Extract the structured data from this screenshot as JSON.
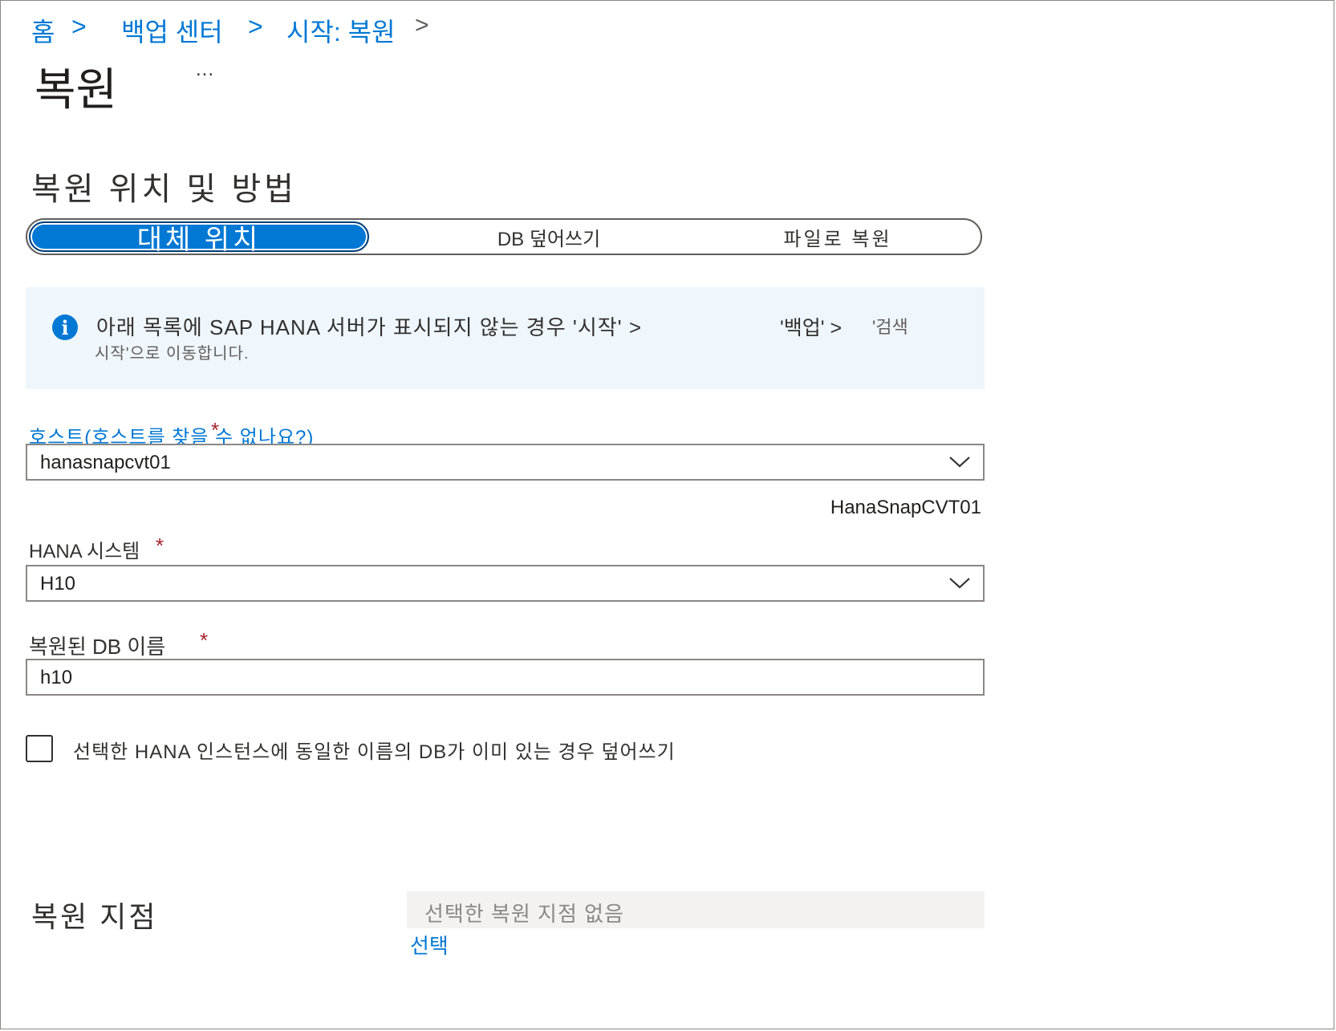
{
  "breadcrumb": {
    "home": "홈",
    "sep": ">",
    "backup_center": "백업 센터",
    "start_restore": "시작: 복원"
  },
  "page": {
    "title": "복원",
    "more": "..."
  },
  "section": {
    "title": "복원 위치 및 방법"
  },
  "restore_method_tabs": [
    {
      "label": "대체 위치",
      "selected": true
    },
    {
      "label": "DB 덮어쓰기",
      "selected": false
    },
    {
      "label": "파일로 복원",
      "selected": false
    }
  ],
  "info": {
    "line1": "아래 목록에 SAP HANA 서버가 표시되지 않는 경우 '시작' >",
    "line1_b": "'백업' >",
    "line1_c": "'검색",
    "line2": "시작'으로 이동합니다."
  },
  "host": {
    "label": "호스트(호스트를 찾을 수 없나요?)",
    "required": "*",
    "value": "hanasnapcvt01",
    "sub": "HanaSnapCVT01"
  },
  "hana_system": {
    "label": "HANA 시스템",
    "required": "*",
    "value": "H10"
  },
  "db_name": {
    "label": "복원된 DB 이름",
    "required": "*",
    "value": "h10"
  },
  "overwrite_checkbox": {
    "label": "선택한 HANA 인스턴스에 동일한 이름의 DB가 이미 있는 경우 덮어쓰기",
    "checked": false
  },
  "restore_point": {
    "title": "복원 지점",
    "placeholder": "선택한 복원 지점 없음",
    "select_link": "선택"
  },
  "colors": {
    "accent": "#0078d4",
    "required": "#a4262c",
    "info_bg": "#eff6fc"
  }
}
